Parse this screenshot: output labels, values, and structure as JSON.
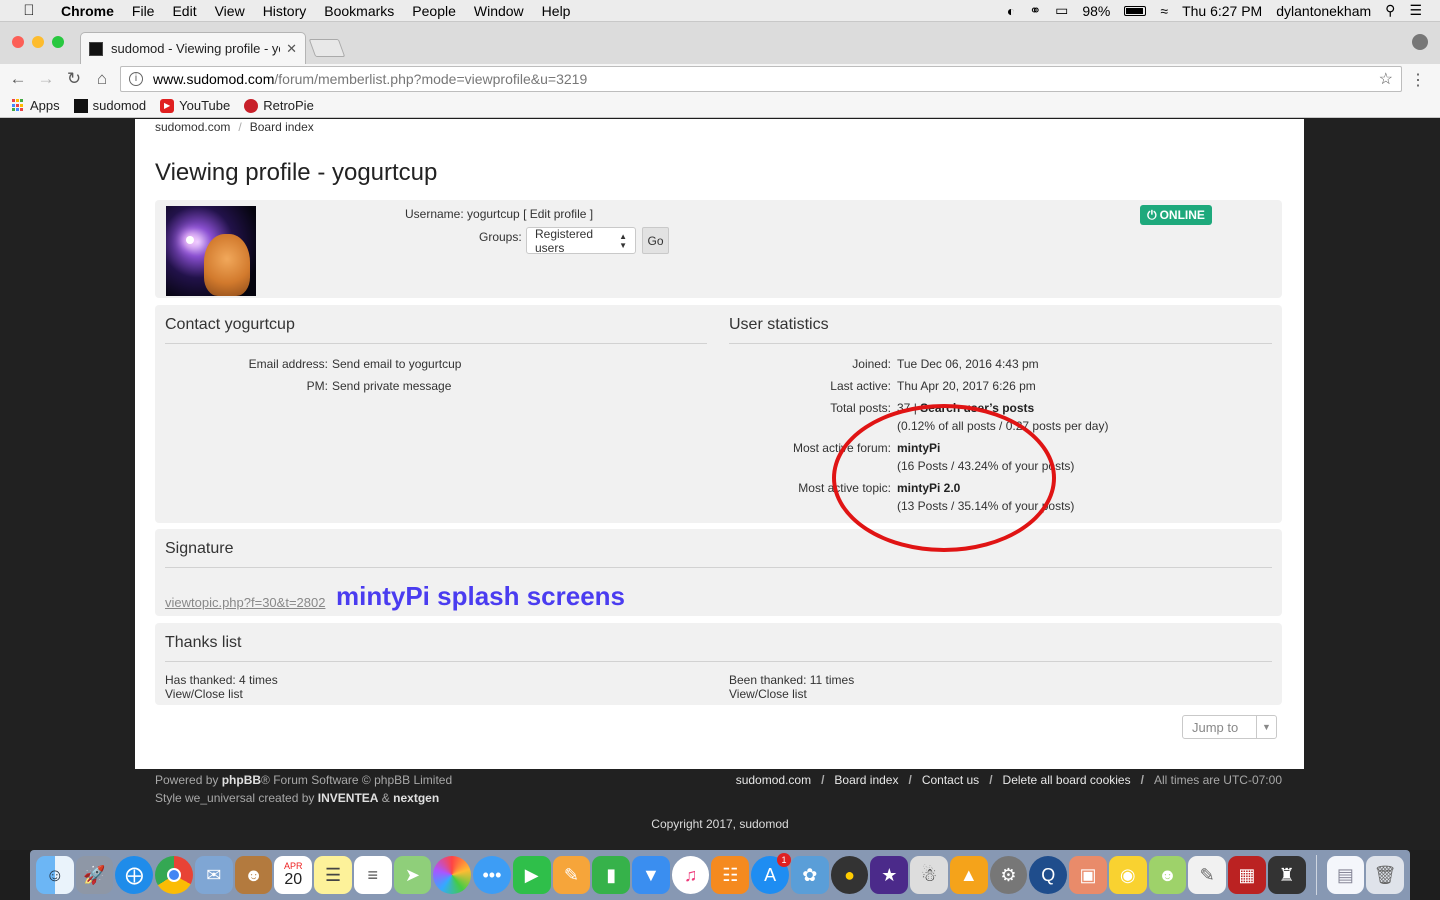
{
  "menubar": {
    "app_name": "Chrome",
    "items": [
      "File",
      "Edit",
      "View",
      "History",
      "Bookmarks",
      "People",
      "Window",
      "Help"
    ],
    "battery": "98%",
    "clock": "Thu 6:27 PM",
    "user": "dylantonekham"
  },
  "browser": {
    "tab_title": "sudomod - Viewing profile - yogurtcup",
    "url_host": "www.sudomod.com",
    "url_path": "/forum/memberlist.php?mode=viewprofile&u=3219",
    "bookmarks": [
      "Apps",
      "sudomod",
      "YouTube",
      "RetroPie"
    ]
  },
  "page": {
    "breadcrumb": [
      "sudomod.com",
      "Board index"
    ],
    "title": "Viewing profile - yogurtcup",
    "profile": {
      "username_label": "Username:",
      "username": "yogurtcup",
      "edit_profile": "[ Edit profile ]",
      "groups_label": "Groups:",
      "group_selected": "Registered users",
      "go_label": "Go",
      "status": "ONLINE"
    },
    "contact": {
      "heading": "Contact yogurtcup",
      "email_label": "Email address:",
      "email_value": "Send email to yogurtcup",
      "pm_label": "PM:",
      "pm_value": "Send private message"
    },
    "stats": {
      "heading": "User statistics",
      "joined_label": "Joined:",
      "joined_value": "Tue Dec 06, 2016 4:43 pm",
      "last_active_label": "Last active:",
      "last_active_value": "Thu Apr 20, 2017 6:26 pm",
      "total_posts_label": "Total posts:",
      "total_posts_value": "37",
      "search_posts": "Search user’s posts",
      "posts_detail": "(0.12% of all posts / 0.27 posts per day)",
      "active_forum_label": "Most active forum:",
      "active_forum_value": "mintyPi",
      "active_forum_detail": "(16 Posts / 43.24% of your posts)",
      "active_topic_label": "Most active topic:",
      "active_topic_value": "mintyPi 2.0",
      "active_topic_detail": "(13 Posts / 35.14% of your posts)"
    },
    "signature": {
      "heading": "Signature",
      "link": "viewtopic.php?f=30&t=2802",
      "text": "mintyPi splash screens"
    },
    "thanks": {
      "heading": "Thanks list",
      "has_thanked": "Has thanked: 4 times",
      "been_thanked": "Been thanked: 11 times",
      "view_list": "View/Close list"
    },
    "jump_to": "Jump to"
  },
  "footer": {
    "powered_prefix": "Powered by",
    "phpbb": "phpBB",
    "powered_suffix": "® Forum Software © phpBB Limited",
    "style_prefix": "Style we_universal created by",
    "inventea": "INVENTEA",
    "amp": "&",
    "nextgen": "nextgen",
    "links": [
      "sudomod.com",
      "Board index",
      "Contact us",
      "Delete all board cookies"
    ],
    "timezone": "All times are UTC-07:00",
    "copyright": "Copyright 2017, sudomod"
  },
  "dock": {
    "icons": [
      "finder-icon",
      "launchpad-icon",
      "safari-icon",
      "chrome-icon",
      "mail-icon",
      "contacts-icon",
      "calendar-icon",
      "notes-icon",
      "reminders-icon",
      "maps-icon",
      "photos-icon",
      "messages-icon",
      "facetime-icon",
      "pages-icon",
      "numbers-icon",
      "keynote-icon",
      "itunes-icon",
      "ibooks-icon",
      "app-store-icon",
      "fish-icon",
      "disc-icon",
      "imovie-icon",
      "invader-icon",
      "vlc-icon",
      "system-preferences-icon",
      "quicktime-icon",
      "preview-icon",
      "cyberduck-icon",
      "game-icon",
      "textedit-icon",
      "photo-booth-icon",
      "chess-icon",
      "document-icon",
      "trash-icon"
    ],
    "calendar_month": "APR",
    "calendar_day": "20",
    "app_store_badge": "1"
  }
}
